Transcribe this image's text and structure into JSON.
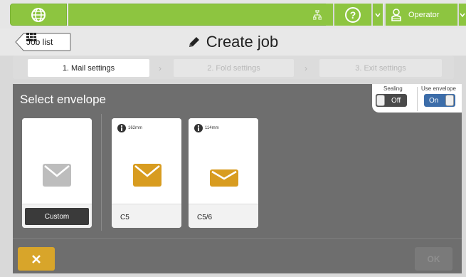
{
  "topbar": {
    "user_label": "Operator",
    "icons": [
      "globe-icon",
      "network-icon",
      "help-icon",
      "chevron-down-icon",
      "user-icon",
      "chevron-down-icon"
    ],
    "accent": "#8dc540"
  },
  "title_row": {
    "back_label": "Job list",
    "title": "Create job"
  },
  "steps": [
    {
      "label": "1. Mail settings",
      "state": "active"
    },
    {
      "label": "2. Fold settings",
      "state": "disabled"
    },
    {
      "label": "3. Exit settings",
      "state": "disabled"
    }
  ],
  "panel": {
    "title": "Select envelope",
    "sealing": {
      "label": "Sealing",
      "value": "Off"
    },
    "use_envelope": {
      "label": "Use envelope",
      "value": "On"
    }
  },
  "cards": [
    {
      "label": "Custom",
      "size": "",
      "envelope_color": "#bdbdbd"
    },
    {
      "label": "C5",
      "size": "162mm",
      "envelope_color": "#d89c20"
    },
    {
      "label": "C5/6",
      "size": "114mm",
      "envelope_color": "#d89c20"
    }
  ],
  "actions": {
    "cancel_icon": "close-icon",
    "ok_label": "OK"
  }
}
